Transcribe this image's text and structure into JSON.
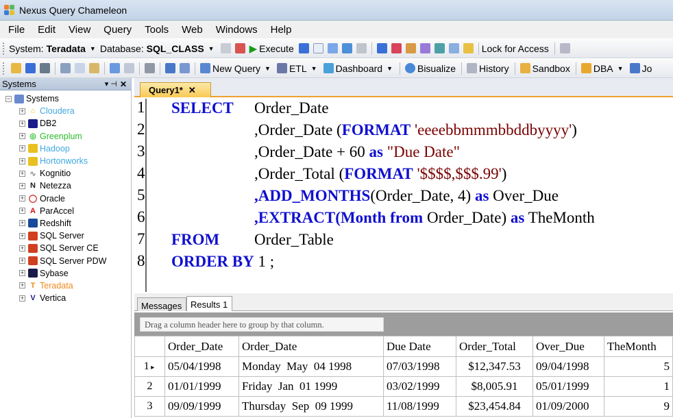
{
  "window": {
    "title": "Nexus Query Chameleon"
  },
  "menu": [
    "File",
    "Edit",
    "View",
    "Query",
    "Tools",
    "Web",
    "Windows",
    "Help"
  ],
  "toolbar1": {
    "system_label": "System:",
    "system_value": "Teradata",
    "database_label": "Database:",
    "database_value": "SQL_CLASS",
    "execute_label": "Execute",
    "lock_label": "Lock for Access"
  },
  "toolbar2": {
    "new_query": "New Query",
    "etl": "ETL",
    "dashboard": "Dashboard",
    "bisualize": "Bisualize",
    "history": "History",
    "sandbox": "Sandbox",
    "dba": "DBA",
    "jo": "Jo"
  },
  "systems_panel": {
    "title": "Systems",
    "root": "Systems",
    "items": [
      {
        "label": "Cloudera",
        "color": "#3fa9e0"
      },
      {
        "label": "DB2",
        "color": "#000000"
      },
      {
        "label": "Greenplum",
        "color": "#2bbd2b"
      },
      {
        "label": "Hadoop",
        "color": "#3fa9e0"
      },
      {
        "label": "Hortonworks",
        "color": "#3fa9e0"
      },
      {
        "label": "Kognitio",
        "color": "#000000"
      },
      {
        "label": "Netezza",
        "color": "#000000"
      },
      {
        "label": "Oracle",
        "color": "#000000"
      },
      {
        "label": "ParAccel",
        "color": "#000000"
      },
      {
        "label": "Redshift",
        "color": "#000000"
      },
      {
        "label": "SQL Server",
        "color": "#000000"
      },
      {
        "label": "SQL Server CE",
        "color": "#000000"
      },
      {
        "label": "SQL Server PDW",
        "color": "#000000"
      },
      {
        "label": "Sybase",
        "color": "#000000"
      },
      {
        "label": "Teradata",
        "color": "#f08a1c"
      },
      {
        "label": "Vertica",
        "color": "#000000"
      }
    ]
  },
  "editor": {
    "tab": "Query1*",
    "line_numbers": [
      "1",
      "2",
      "3",
      "4",
      "5",
      "6",
      "7",
      "8"
    ],
    "l1_kw": "SELECT",
    "l1_a": "Order_Date",
    "l2_a": ",Order_Date (",
    "l2_kw": "FORMAT",
    "l2_s": " 'eeeebbmmmbbddbyyyy'",
    "l2_b": ")",
    "l3_a": ",Order_Date + 60 ",
    "l3_kw": "as",
    "l3_s": " \"Due Date\"",
    "l4_a": ",Order_Total (",
    "l4_kw": "FORMAT",
    "l4_s": " '$$$$,$$$.99'",
    "l4_b": ")",
    "l5_kw": ",ADD_MONTHS",
    "l5_a": "(Order_Date, 4) ",
    "l5_kw2": "as",
    "l5_b": " Over_Due",
    "l6_kw": ",EXTRACT(",
    "l6_kw2": "Month",
    "l6_a": " ",
    "l6_kw3": "from",
    "l6_b": " Order_Date) ",
    "l6_kw4": "as",
    "l6_c": " TheMonth",
    "l7_kw": "FROM",
    "l7_a": "Order_Table",
    "l8_kw": "ORDER BY",
    "l8_a": " 1 ;"
  },
  "results": {
    "tab_messages": "Messages",
    "tab_results": "Results 1",
    "group_hint": "Drag a column header here to group by that column.",
    "columns": [
      "Order_Date",
      "Order_Date",
      "Due Date",
      "Order_Total",
      "Over_Due",
      "TheMonth"
    ],
    "rows": [
      {
        "n": "1",
        "c": [
          "05/04/1998",
          "Monday  May  04 1998",
          "07/03/1998",
          "$12,347.53",
          "09/04/1998",
          "5"
        ]
      },
      {
        "n": "2",
        "c": [
          "01/01/1999",
          "Friday  Jan  01 1999",
          "03/02/1999",
          "$8,005.91",
          "05/01/1999",
          "1"
        ]
      },
      {
        "n": "3",
        "c": [
          "09/09/1999",
          "Thursday  Sep  09 1999",
          "11/08/1999",
          "$23,454.84",
          "01/09/2000",
          "9"
        ]
      }
    ]
  }
}
